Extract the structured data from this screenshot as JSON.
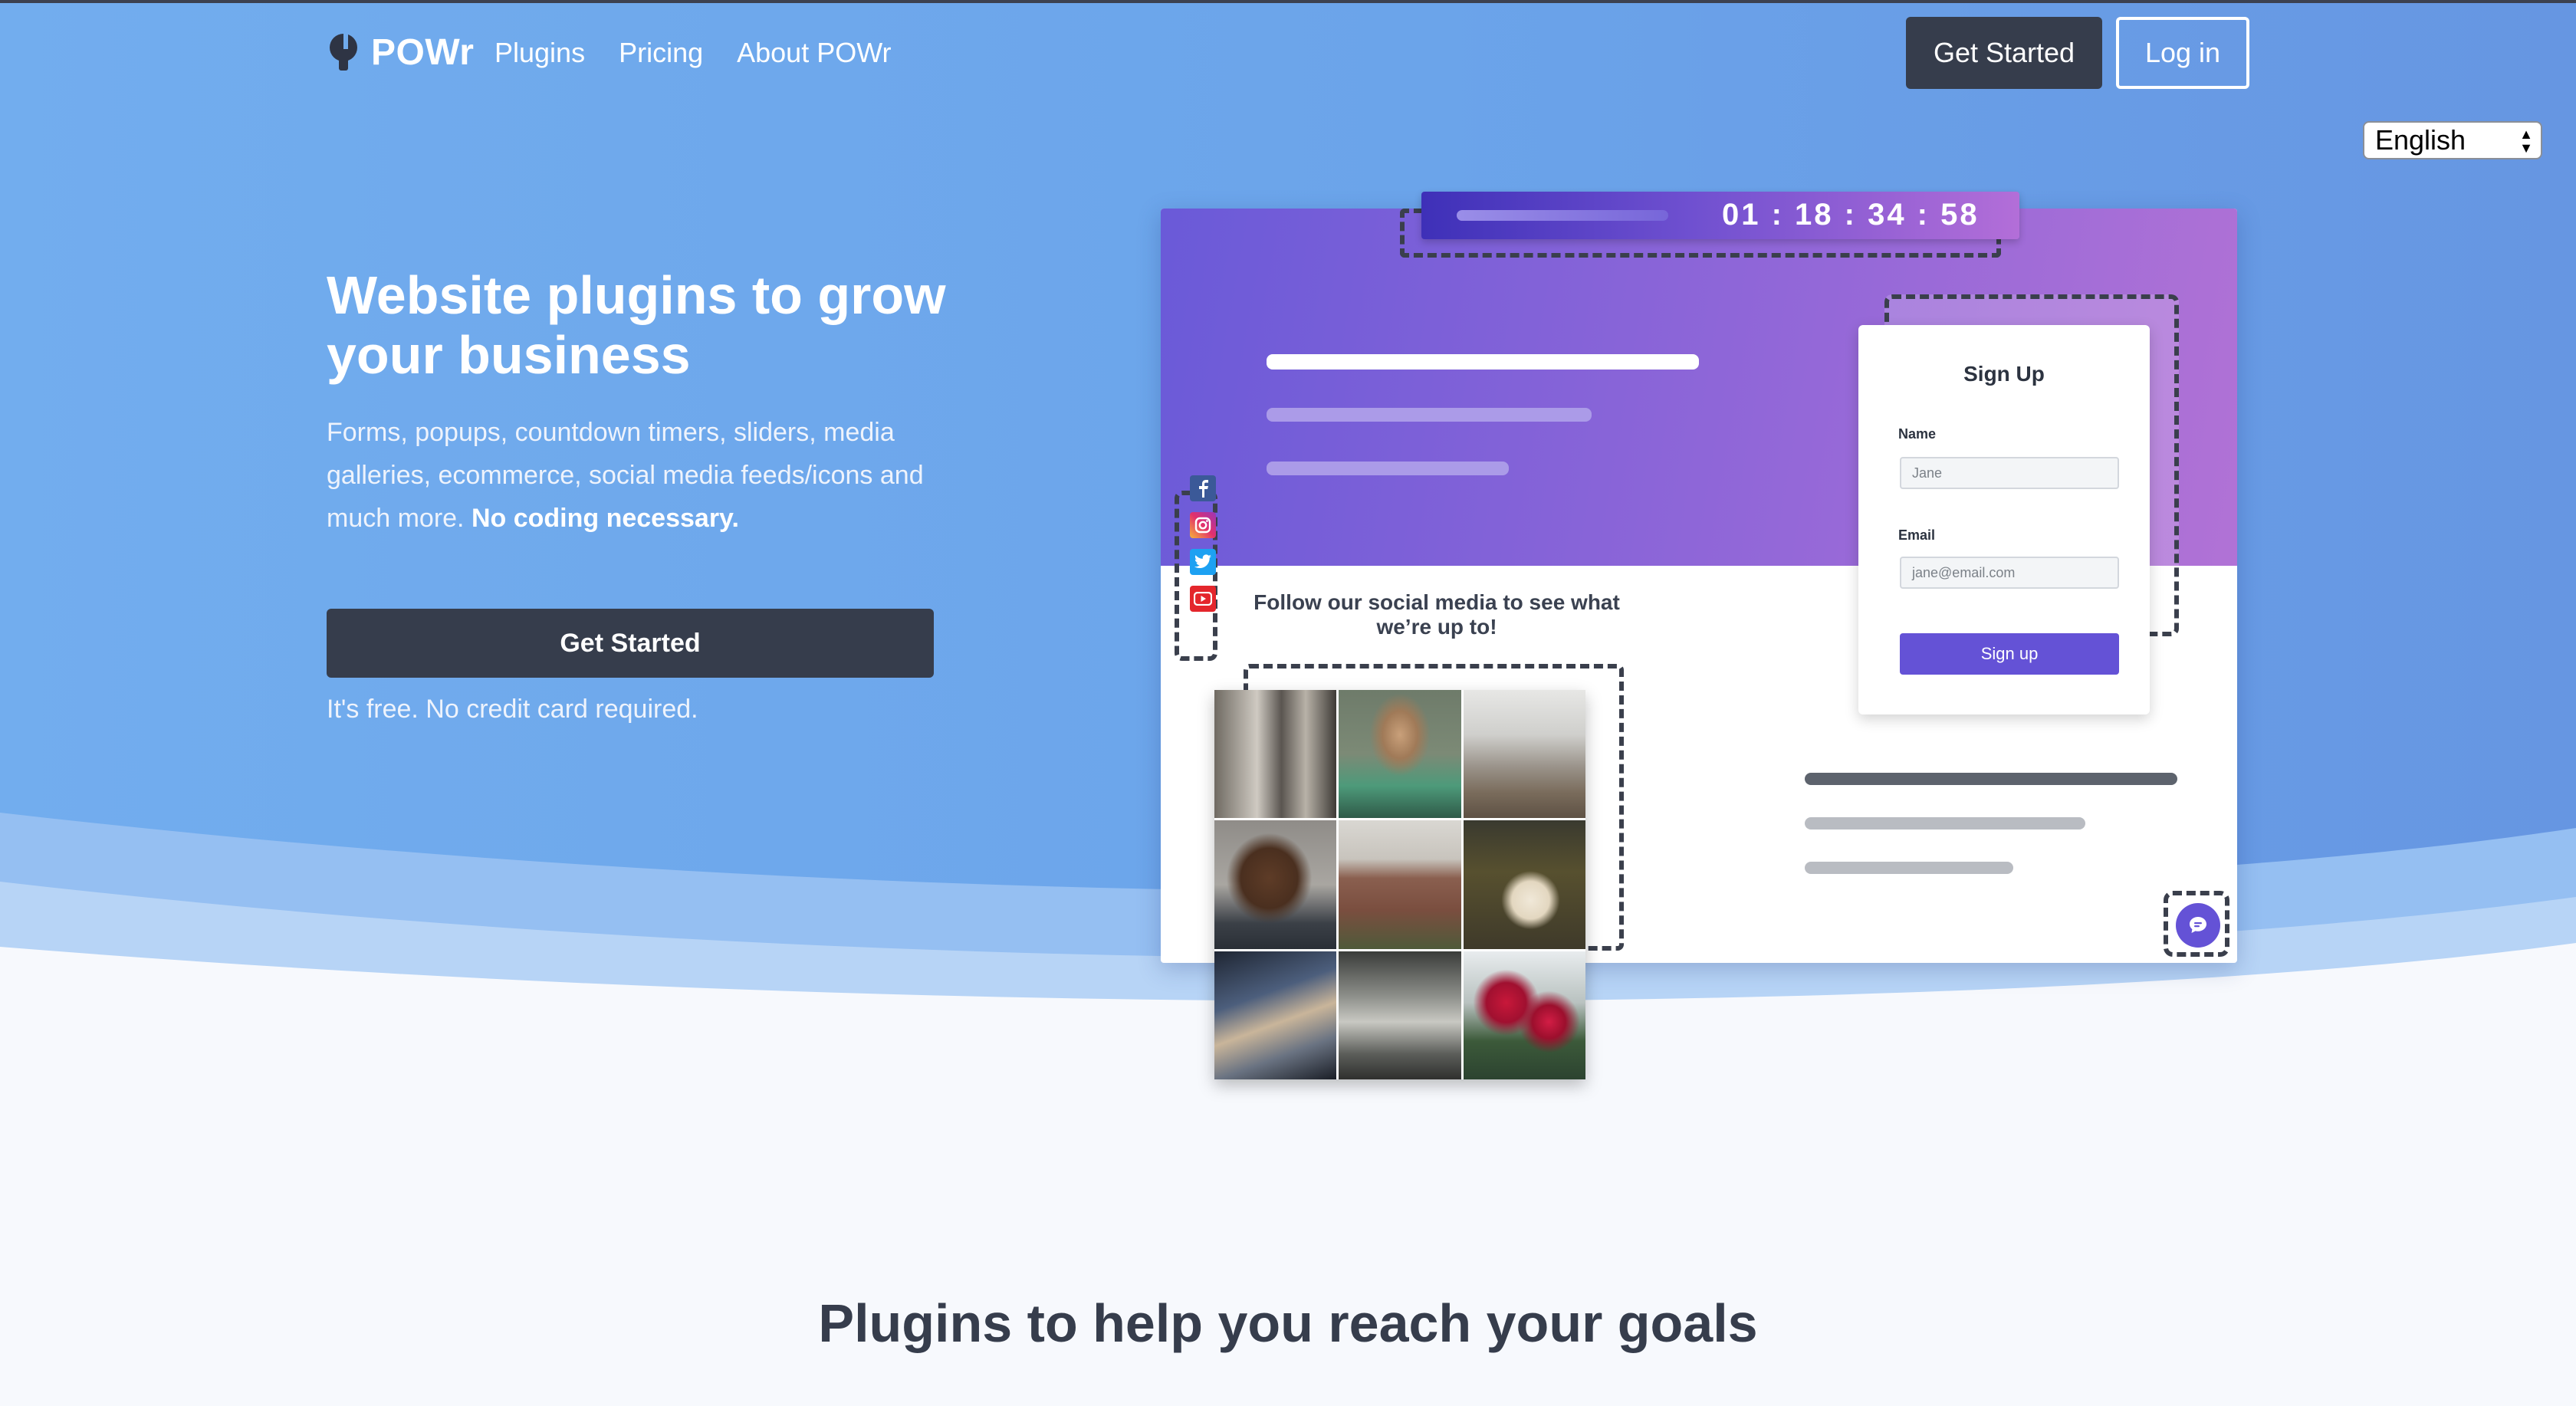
{
  "nav": {
    "logo_text": "POWr",
    "links": [
      "Plugins",
      "Pricing",
      "About POWr"
    ],
    "get_started": "Get Started",
    "login": "Log in"
  },
  "language": {
    "selected": "English"
  },
  "hero": {
    "title": "Website plugins to grow your business",
    "subtitle": "Forms, popups, countdown timers, sliders, media galleries, ecommerce, social media feeds/icons and much more.",
    "subtitle_bold": "No coding necessary.",
    "cta": "Get Started",
    "note": "It's free. No credit card required."
  },
  "illustration": {
    "timer": "01 : 18 : 34 : 58",
    "form": {
      "title": "Sign Up",
      "name_label": "Name",
      "name_placeholder": "Jane",
      "email_label": "Email",
      "email_placeholder": "jane@email.com",
      "button": "Sign up"
    },
    "follow_text": "Follow our social media to see what we’re up to!",
    "social_icons": [
      "facebook-icon",
      "instagram-icon",
      "twitter-icon",
      "youtube-icon"
    ],
    "chat_icon": "chat-icon"
  },
  "section": {
    "title": "Plugins to help you reach your goals"
  },
  "colors": {
    "hero_blue": "#6aa6ea",
    "dark_button": "#363d4c",
    "accent_purple": "#6452d6"
  }
}
